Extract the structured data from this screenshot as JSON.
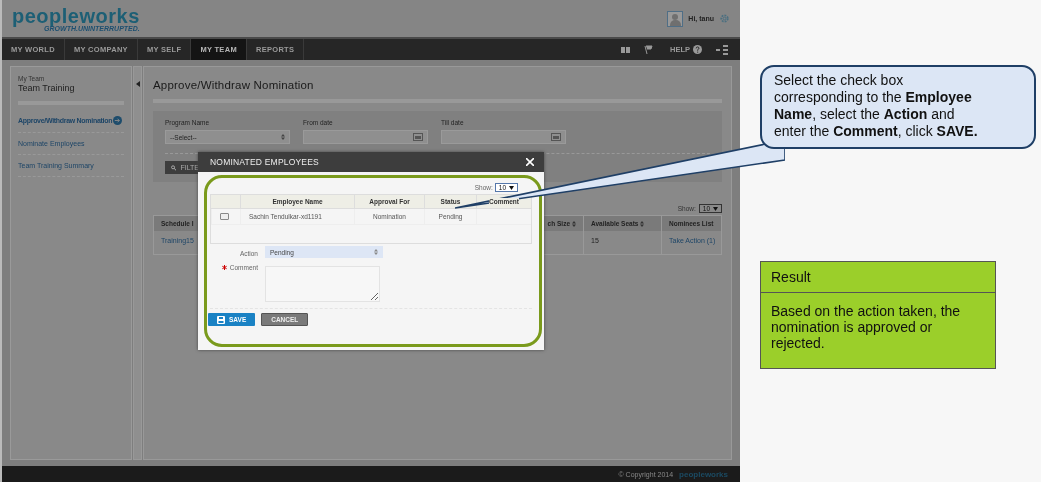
{
  "app": {
    "logo": "peopleworks",
    "tagline": "GROWTH.UNINTERRUPTED.",
    "greeting": "Hi, tanu"
  },
  "nav": {
    "tabs": [
      {
        "label": "MY WORLD",
        "selected": false
      },
      {
        "label": "MY COMPANY",
        "selected": false
      },
      {
        "label": "MY SELF",
        "selected": false
      },
      {
        "label": "MY TEAM",
        "selected": true
      },
      {
        "label": "REPORTS",
        "selected": false
      }
    ],
    "help": "HELP"
  },
  "sidebar": {
    "section": "My Team",
    "title": "Team Training",
    "items": [
      {
        "label": "Approve/Withdraw Nomination",
        "selected": true
      },
      {
        "label": "Nominate Employees",
        "selected": false
      },
      {
        "label": "Team Training Summary",
        "selected": false
      }
    ]
  },
  "page": {
    "title": "Approve/Withdraw Nomination",
    "filters": [
      {
        "label": "Program Name",
        "kind": "select",
        "value": "--Select--"
      },
      {
        "label": "From date",
        "kind": "date"
      },
      {
        "label": "Till date",
        "kind": "date"
      }
    ],
    "filter_button": "FILTE",
    "show_label": "Show:",
    "show_value": "10",
    "table": {
      "columns": [
        {
          "label": "Schedule I"
        },
        {
          "label": "ch Size",
          "sortable": true
        },
        {
          "label": "Available Seats",
          "sortable": true
        },
        {
          "label": "Nominees List"
        }
      ],
      "rows": [
        {
          "schedule": "Training15",
          "seats": "15",
          "nominees": "Take Action (1)"
        }
      ]
    }
  },
  "modal": {
    "title": "NOMINATED EMPLOYEES",
    "show_label": "Show:",
    "show_value": "10",
    "columns": [
      "Employee Name",
      "Approval For",
      "Status",
      "Comment"
    ],
    "rows": [
      {
        "checked": false,
        "employee": "Sachin Tendulkar-xd1191",
        "approval_for": "Nomination",
        "status": "Pending"
      }
    ],
    "action": {
      "label": "Action",
      "value": "Pending"
    },
    "comment": {
      "label": "Comment",
      "required": true
    },
    "buttons": [
      {
        "label": "SAVE",
        "kind": "primary"
      },
      {
        "label": "CANCEL",
        "kind": "secondary"
      }
    ]
  },
  "footer": {
    "copyright": "© Copyright 2014",
    "logo": "peopleworks"
  },
  "callout": {
    "text": "Select the check box corresponding to the **Employee Name**, select the **Action** and enter the **Comment**, click **SAVE.**"
  },
  "result": {
    "title": "Result",
    "text": "Based on the action taken, the nomination is approved or rejected."
  }
}
